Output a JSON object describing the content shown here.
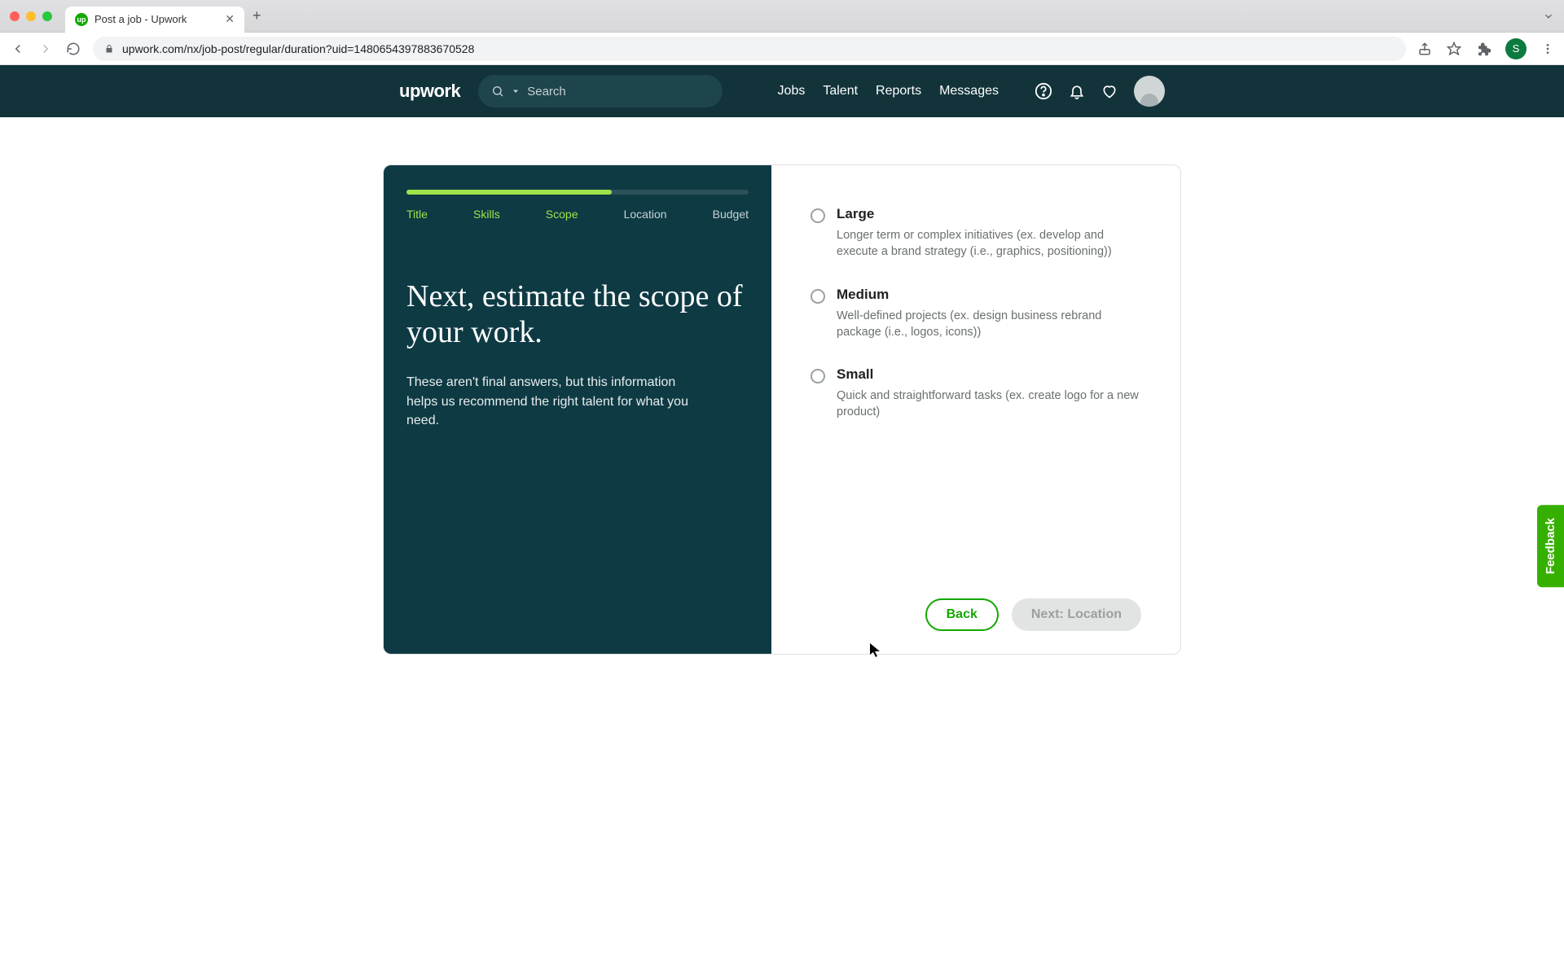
{
  "browser": {
    "tab_title": "Post a job - Upwork",
    "url": "upwork.com/nx/job-post/regular/duration?uid=1480654397883670528",
    "avatar_initial": "S"
  },
  "nav": {
    "logo": "upwork",
    "search_placeholder": "Search",
    "links": [
      "Jobs",
      "Talent",
      "Reports",
      "Messages"
    ]
  },
  "wizard": {
    "steps": [
      {
        "label": "Title",
        "done": true
      },
      {
        "label": "Skills",
        "done": true
      },
      {
        "label": "Scope",
        "done": true
      },
      {
        "label": "Location",
        "done": false
      },
      {
        "label": "Budget",
        "done": false
      }
    ],
    "progress_percent": 60,
    "headline": "Next, estimate the scope of your work.",
    "subtext": "These aren't final answers, but this information helps us recommend the right talent for what you need."
  },
  "options": [
    {
      "title": "Large",
      "desc": "Longer term or complex initiatives (ex. develop and execute a brand strategy (i.e., graphics, positioning))"
    },
    {
      "title": "Medium",
      "desc": "Well-defined projects (ex. design business rebrand package (i.e., logos, icons))"
    },
    {
      "title": "Small",
      "desc": "Quick and straightforward tasks (ex. create logo for a new product)"
    }
  ],
  "buttons": {
    "back": "Back",
    "next": "Next: Location"
  },
  "feedback_label": "Feedback"
}
